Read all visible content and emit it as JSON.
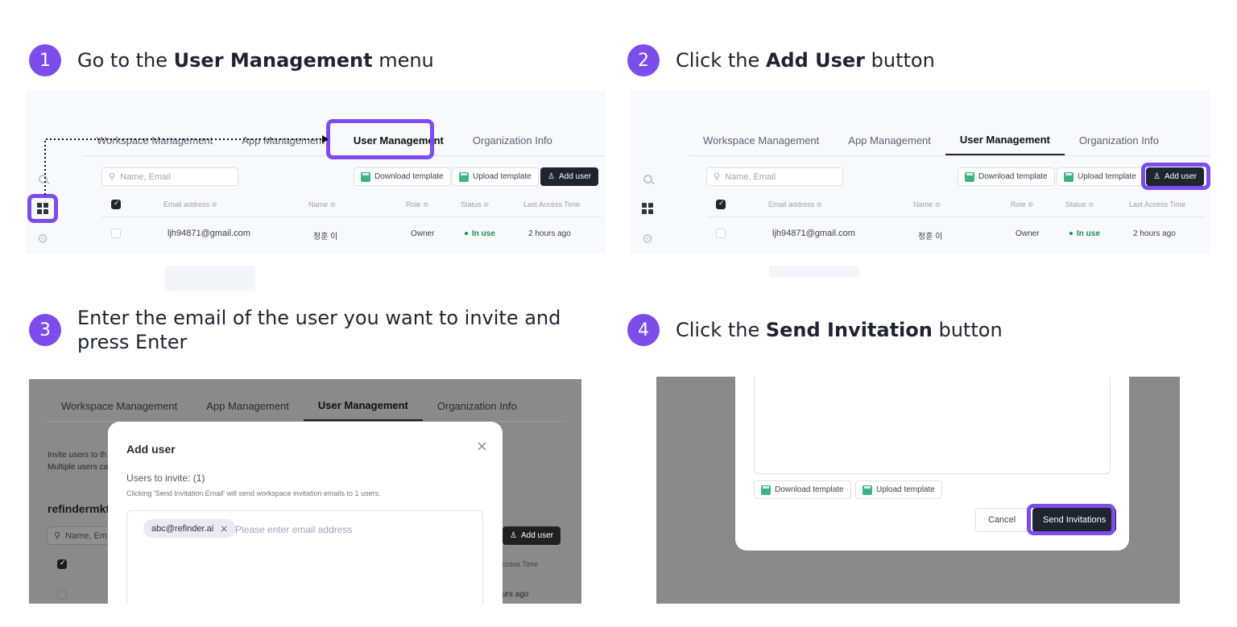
{
  "accent_color": "#7c4dea",
  "steps": [
    {
      "number": "1",
      "pre": "Go to the ",
      "bold": "User Management",
      "post": " menu"
    },
    {
      "number": "2",
      "pre": "Click the ",
      "bold": "Add User",
      "post": " button"
    },
    {
      "number": "3",
      "line1": "Enter the email of the user you want to invite and",
      "line2": "press Enter"
    },
    {
      "number": "4",
      "pre": "Click the ",
      "bold": "Send Invitation",
      "post": " button"
    }
  ],
  "tabs": [
    "Workspace Management",
    "App Management",
    "User Management",
    "Organization Info"
  ],
  "search_placeholder": "Name, Email",
  "buttons": {
    "download_template": "Download template",
    "upload_template": "Upload template",
    "add_user": "Add user",
    "cancel": "Cancel",
    "send_invitations": "Send Invitations"
  },
  "table": {
    "headers": [
      "Email address ≎",
      "Name ≎",
      "Role ≎",
      "Status ≎",
      "Last Access Time"
    ],
    "row": {
      "email": "ljh94871@gmail.com",
      "name": "정훈 이",
      "role": "Owner",
      "status": "In use",
      "last_access": "2 hours ago"
    }
  },
  "step3_bg": {
    "invite_text_1": "Invite users to th",
    "invite_text_2": "Multiple users ca",
    "workspace": "refindermkt",
    "search_partial": "Name, Em",
    "last_access_partial": "ccess Time",
    "hours_partial": "urs ago"
  },
  "modal": {
    "title": "Add user",
    "users_to_invite": "Users to invite: (1)",
    "hint": "Clicking 'Send Invitation Email' will send workspace invitation emails to 1 users.",
    "chip_email": "abc@refinder.ai",
    "email_placeholder": "Please enter email address"
  },
  "icons": [
    "search-icon",
    "apps-grid-icon",
    "settings-gear-icon",
    "csv-file-icon",
    "add-person-icon",
    "close-icon",
    "chip-remove-icon"
  ]
}
